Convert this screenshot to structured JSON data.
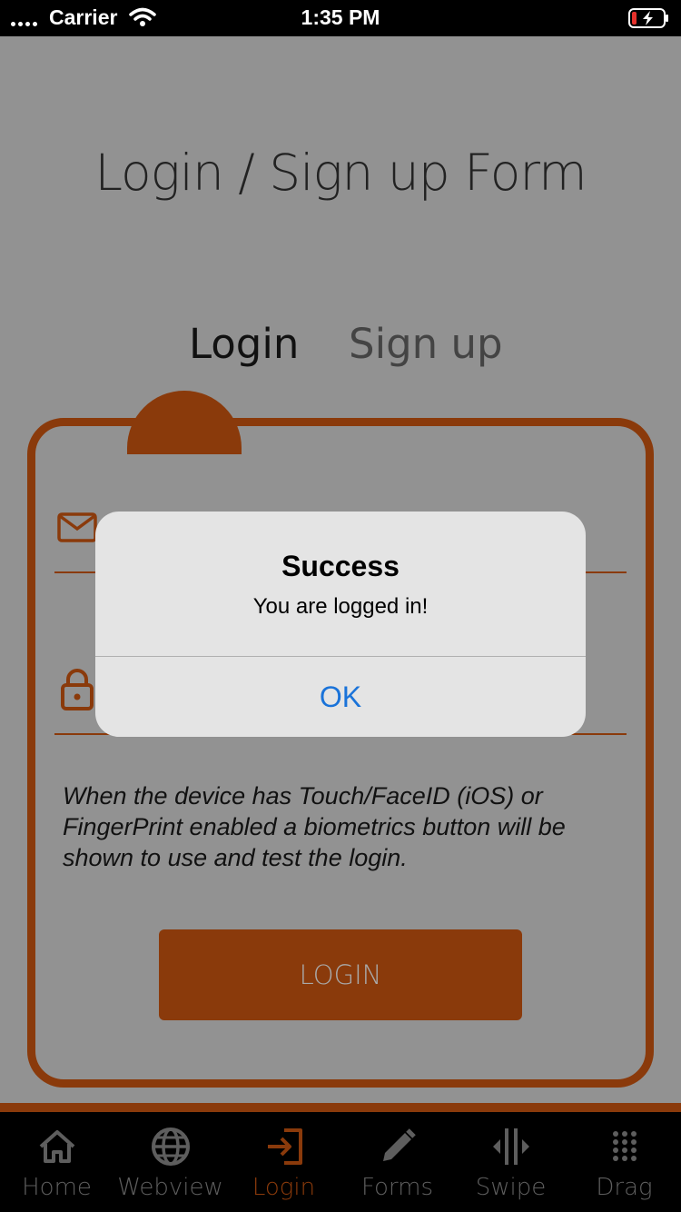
{
  "status_bar": {
    "carrier": "Carrier",
    "time": "1:35 PM"
  },
  "page": {
    "title": "Login / Sign up Form",
    "tabs": [
      {
        "label": "Login",
        "active": true
      },
      {
        "label": "Sign up",
        "active": false
      }
    ],
    "biometric_note": "When the device has Touch/FaceID (iOS) or FingerPrint enabled a biometrics button will be shown to use and test the login.",
    "login_button_label": "LOGIN"
  },
  "alert": {
    "title": "Success",
    "message": "You are logged in!",
    "ok_label": "OK"
  },
  "tabbar": {
    "items": [
      {
        "label": "Home",
        "icon": "home-icon"
      },
      {
        "label": "Webview",
        "icon": "globe-icon"
      },
      {
        "label": "Login",
        "icon": "login-icon",
        "active": true
      },
      {
        "label": "Forms",
        "icon": "pencil-icon"
      },
      {
        "label": "Swipe",
        "icon": "swipe-icon"
      },
      {
        "label": "Drag",
        "icon": "grid-icon"
      }
    ]
  },
  "colors": {
    "accent": "#8a3a0b",
    "overlay_background": "#929292",
    "alert_button": "#1a73d9"
  }
}
